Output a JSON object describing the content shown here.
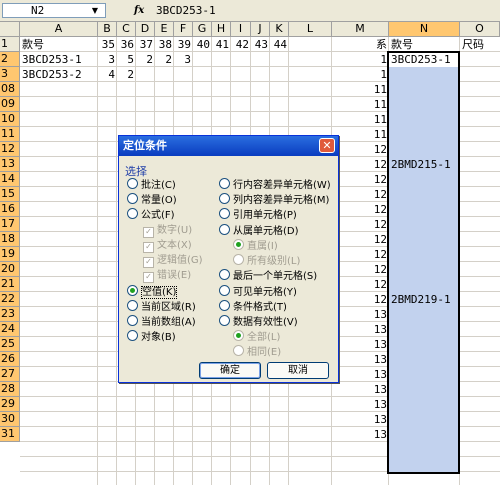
{
  "formula_bar": {
    "name_box": "N2",
    "fx": "fx",
    "formula": "3BCD253-1"
  },
  "columns": [
    "A",
    "B",
    "C",
    "D",
    "E",
    "F",
    "G",
    "H",
    "I",
    "J",
    "K",
    "L",
    "M",
    "N",
    "O"
  ],
  "rows": [
    "1",
    "2",
    "3",
    "08",
    "09",
    "10",
    "11",
    "12",
    "13",
    "14",
    "15",
    "16",
    "17",
    "18",
    "19",
    "20",
    "21",
    "22",
    "23",
    "24",
    "25",
    "26",
    "27",
    "28",
    "29",
    "30",
    "31"
  ],
  "sheet": {
    "header_row": [
      "款号",
      "35",
      "36",
      "37",
      "38",
      "39",
      "40",
      "41",
      "42",
      "43",
      "44",
      "",
      "系",
      "款号",
      "尺码"
    ],
    "row2": [
      "3BCD253-1",
      "3",
      "5",
      "2",
      "2",
      "3",
      "1",
      "3BCD253-1"
    ],
    "row3": [
      "3BCD253-2",
      "4",
      "2",
      "1"
    ],
    "col_m": [
      "1",
      "1",
      "11",
      "11",
      "11",
      "11",
      "12",
      "12",
      "12",
      "12",
      "12",
      "12",
      "12",
      "12",
      "12",
      "12",
      "12",
      "13",
      "13",
      "13",
      "13",
      "13",
      "13",
      "13",
      "13",
      "13"
    ],
    "n_labels": {
      "row12": "2BMD215-1",
      "row21": "2BMD219-1"
    }
  },
  "dialog": {
    "title": "定位条件",
    "group": "选择",
    "left_options": [
      {
        "label": "批注(C)"
      },
      {
        "label": "常量(O)"
      },
      {
        "label": "公式(F)"
      }
    ],
    "formula_checks": [
      "数字(U)",
      "文本(X)",
      "逻辑值(G)",
      "错误(E)"
    ],
    "left_options2": [
      {
        "label": "空值(K)"
      },
      {
        "label": "当前区域(R)"
      },
      {
        "label": "当前数组(A)"
      },
      {
        "label": "对象(B)"
      }
    ],
    "right_options": [
      {
        "label": "行内容差异单元格(W)"
      },
      {
        "label": "列内容差异单元格(M)"
      },
      {
        "label": "引用单元格(P)"
      },
      {
        "label": "从属单元格(D)"
      }
    ],
    "dependent_sub": [
      "直属(I)",
      "所有级别(L)"
    ],
    "right_options2": [
      {
        "label": "最后一个单元格(S)"
      },
      {
        "label": "可见单元格(Y)"
      },
      {
        "label": "条件格式(T)"
      },
      {
        "label": "数据有效性(V)"
      }
    ],
    "validation_sub": [
      "全部(L)",
      "相同(E)"
    ],
    "ok": "确定",
    "cancel": "取消"
  }
}
